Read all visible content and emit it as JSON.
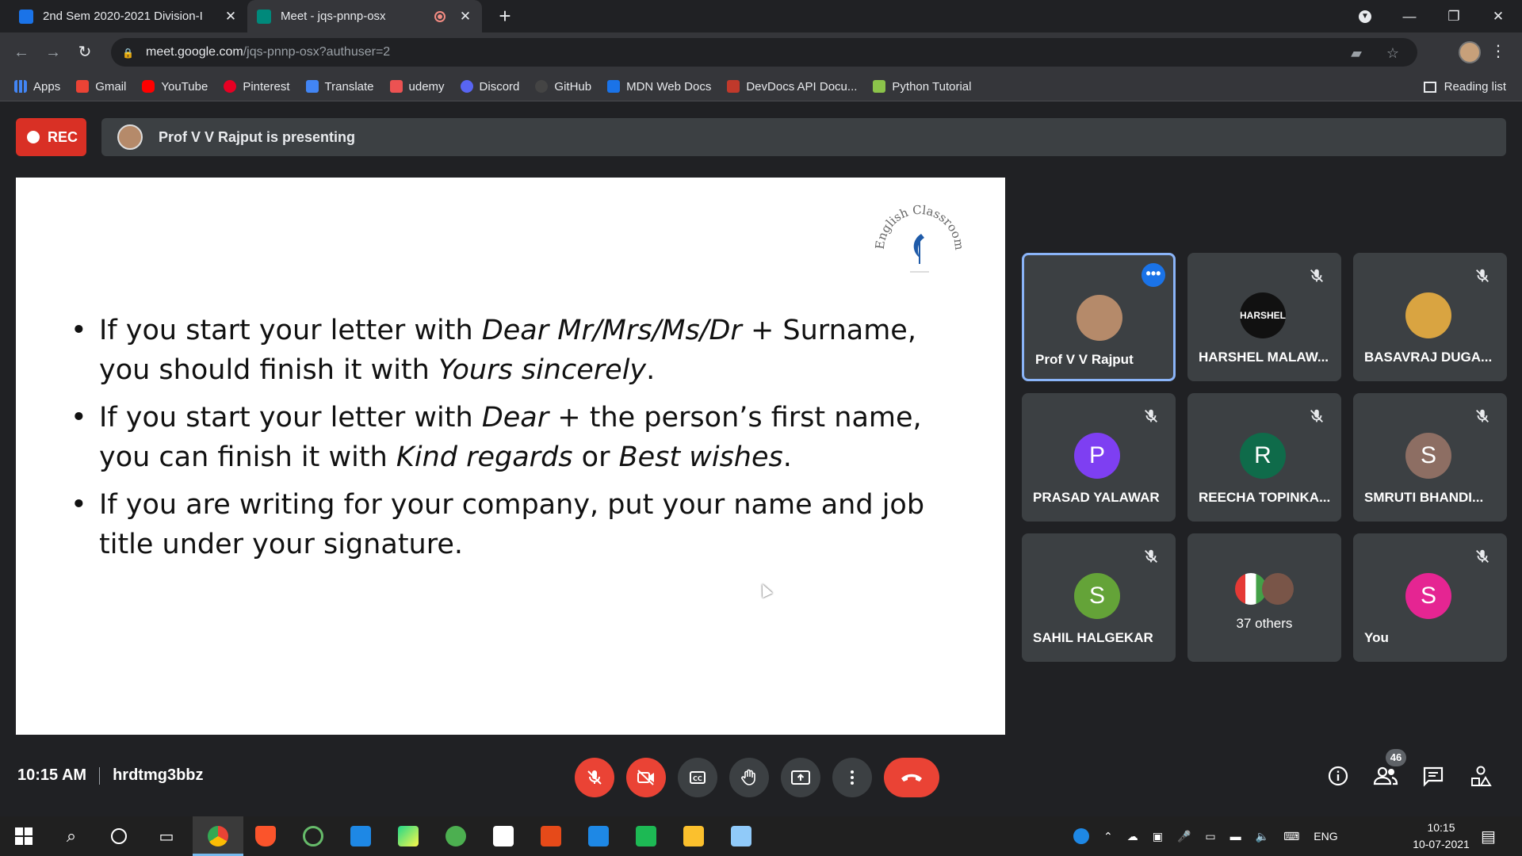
{
  "browser": {
    "tabs": [
      {
        "title": "2nd Sem 2020-2021 Division-I",
        "active": false,
        "favicon_color": "#1a73e8"
      },
      {
        "title": "Meet - jqs-pnnp-osx",
        "active": true,
        "favicon_color": "#00897b"
      }
    ],
    "url_host": "meet.google.com",
    "url_path": "/jqs-pnnp-osx?authuser=2",
    "bookmarks": [
      {
        "label": "Apps",
        "icon": "apps-grid-icon",
        "color": "#4285f4"
      },
      {
        "label": "Gmail",
        "icon": "gmail-icon",
        "color": "#ea4335"
      },
      {
        "label": "YouTube",
        "icon": "youtube-icon",
        "color": "#ff0000"
      },
      {
        "label": "Pinterest",
        "icon": "pinterest-icon",
        "color": "#e60023"
      },
      {
        "label": "Translate",
        "icon": "translate-icon",
        "color": "#4285f4"
      },
      {
        "label": "udemy",
        "icon": "udemy-icon",
        "color": "#ec5252"
      },
      {
        "label": "Discord",
        "icon": "discord-icon",
        "color": "#5865f2"
      },
      {
        "label": "GitHub",
        "icon": "github-icon",
        "color": "#444444"
      },
      {
        "label": "MDN Web Docs",
        "icon": "mdn-icon",
        "color": "#1a73e8"
      },
      {
        "label": "DevDocs API Docu...",
        "icon": "devdocs-icon",
        "color": "#c0392b"
      },
      {
        "label": "Python Tutorial",
        "icon": "python-tutorial-icon",
        "color": "#8bc34a"
      }
    ],
    "reading_list": "Reading list"
  },
  "meet": {
    "rec_label": "REC",
    "presenting_text": "Prof V V Rajput is presenting",
    "slide": {
      "logo_text": "English Classroom",
      "bullets": [
        [
          "If you start your letter with ",
          "Dear Mr/Mrs/Ms/Dr",
          " + Surname, you should finish it with ",
          "Yours sincerely",
          "."
        ],
        [
          "If you start your letter with ",
          "Dear",
          " + the person’s first name, you can finish it with ",
          "Kind regards",
          " or ",
          "Best wishes",
          "."
        ],
        [
          "If you are writing for your company, put your name and job title under your signature."
        ]
      ]
    },
    "participants": [
      {
        "name": "Prof V V Rajput",
        "initial": "",
        "color": "#b58a6a",
        "muted": false,
        "active": true
      },
      {
        "name": "HARSHEL MALAW...",
        "initial": "HARSHEL",
        "color": "#111111",
        "muted": true,
        "active": false
      },
      {
        "name": "BASAVRAJ DUGA...",
        "initial": "",
        "color": "#d9a441",
        "muted": true,
        "active": false
      },
      {
        "name": "PRASAD YALAWAR",
        "initial": "P",
        "color": "#7e3ff2",
        "muted": true,
        "active": false
      },
      {
        "name": "REECHA TOPINKA...",
        "initial": "R",
        "color": "#0f6b4a",
        "muted": true,
        "active": false
      },
      {
        "name": "SMRUTI BHANDI...",
        "initial": "S",
        "color": "#8d6e63",
        "muted": true,
        "active": false
      },
      {
        "name": "SAHIL HALGEKAR",
        "initial": "S",
        "color": "#64a338",
        "muted": true,
        "active": false
      },
      {
        "name": "37 others",
        "initial": "",
        "color": "#3c4043",
        "muted": false,
        "active": false
      },
      {
        "name": "You",
        "initial": "S",
        "color": "#e52592",
        "muted": true,
        "active": false
      }
    ],
    "time": "10:15 AM",
    "meeting_code": "hrdtmg3bbz",
    "people_count": "46"
  },
  "taskbar": {
    "language": "ENG",
    "clock_time": "10:15",
    "clock_date": "10-07-2021"
  }
}
